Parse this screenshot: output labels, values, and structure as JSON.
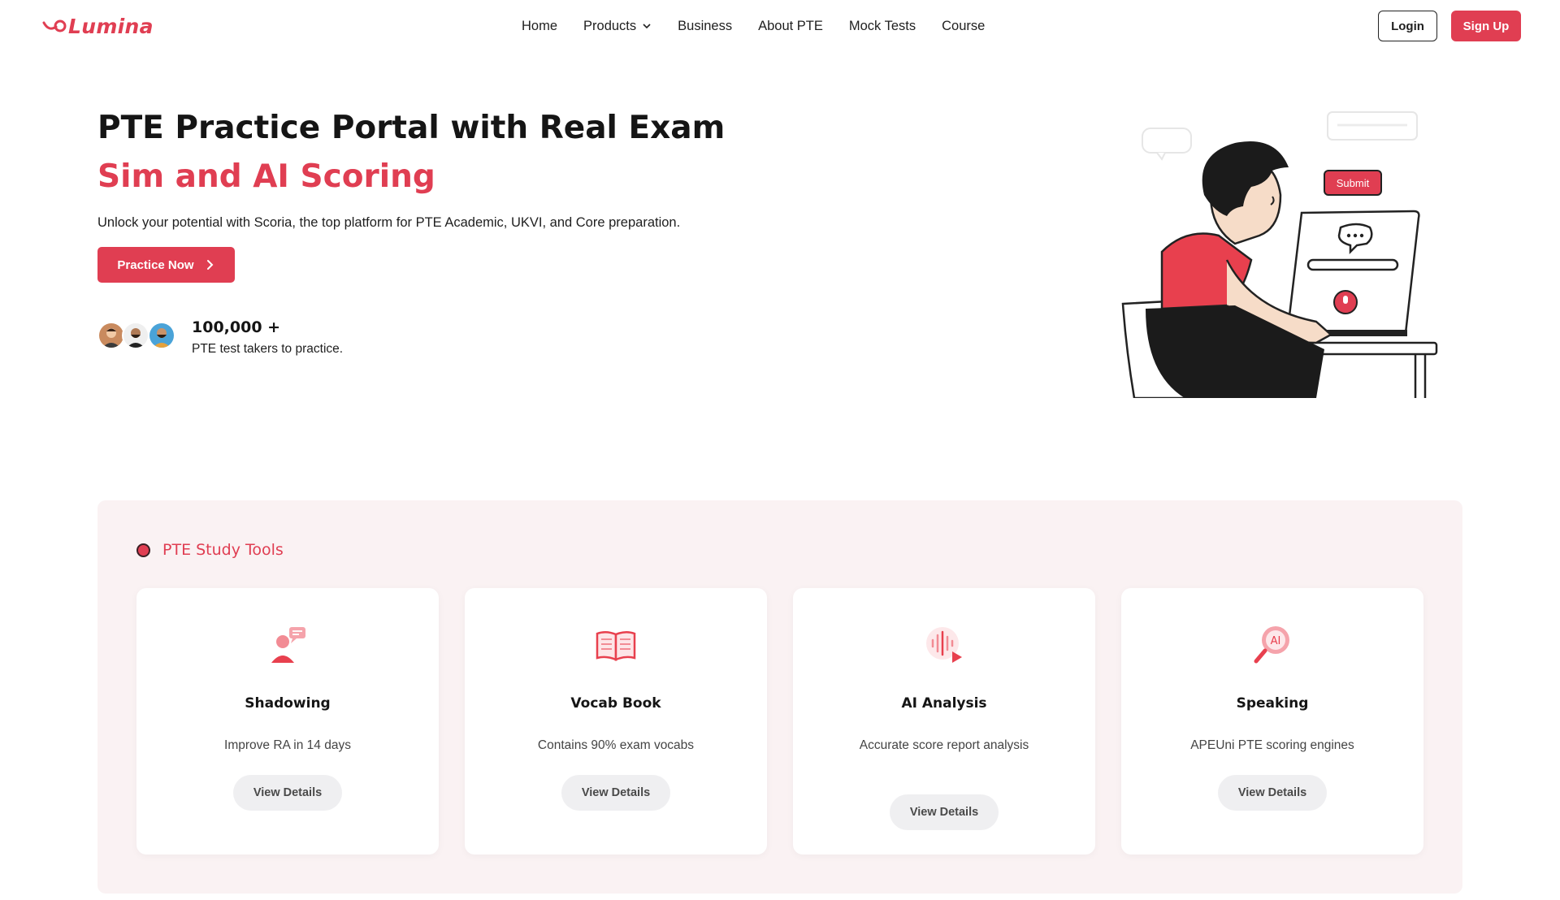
{
  "header": {
    "logo_text": "Lumina",
    "nav": [
      {
        "label": "Home"
      },
      {
        "label": "Products"
      },
      {
        "label": "Business"
      },
      {
        "label": "About PTE"
      },
      {
        "label": "Mock Tests"
      },
      {
        "label": "Course"
      }
    ],
    "login_label": "Login",
    "signup_label": "Sign Up"
  },
  "hero": {
    "title_part1": "PTE Practice Portal with Real Exam ",
    "title_accent": "Sim and AI Scoring",
    "subtitle": "Unlock your potential with Scoria, the top platform for PTE Academic, UKVI, and Core preparation.",
    "cta_label": "Practice Now",
    "takers_count": "100,000 +",
    "takers_label": "PTE test takers to practice.",
    "illustration_submit_label": "Submit"
  },
  "tools": {
    "heading": "PTE Study Tools",
    "cards": [
      {
        "title": "Shadowing",
        "desc": "Improve RA in 14 days",
        "button": "View Details",
        "icon": "shadowing-icon"
      },
      {
        "title": "Vocab Book",
        "desc": "Contains 90% exam vocabs",
        "button": "View Details",
        "icon": "book-icon"
      },
      {
        "title": "AI Analysis",
        "desc": "Accurate score report analysis",
        "button": "View Details",
        "icon": "sound-wave-icon"
      },
      {
        "title": "Speaking",
        "desc": "APEUni PTE scoring engines",
        "button": "View Details",
        "icon": "ai-speaking-icon"
      }
    ]
  },
  "colors": {
    "accent": "#e03e52",
    "tools_background": "#faf2f3",
    "button_grey": "#efeff1"
  }
}
